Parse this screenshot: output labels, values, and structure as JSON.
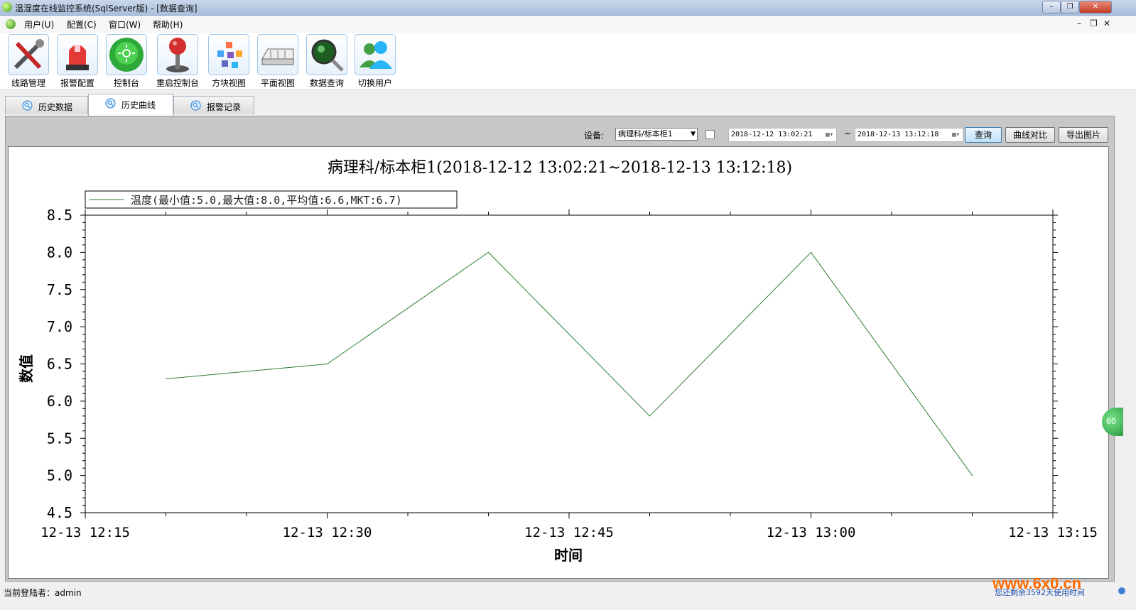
{
  "window": {
    "title": "温湿度在线监控系统(SqlServer版) - [数据查询]"
  },
  "menu": [
    "用户(U)",
    "配置(C)",
    "窗口(W)",
    "帮助(H)"
  ],
  "mdi_controls": {
    "minimize": "–",
    "restore": "❐",
    "close": "✕"
  },
  "toolbar": [
    {
      "label": "线路管理",
      "icon": "tools-icon"
    },
    {
      "label": "报警配置",
      "icon": "alarm-light-icon"
    },
    {
      "label": "控制台",
      "icon": "console-icon"
    },
    {
      "label": "重启控制台",
      "icon": "joystick-icon"
    },
    {
      "label": "方块视图",
      "icon": "block-view-icon"
    },
    {
      "label": "平面视图",
      "icon": "floor-plan-icon"
    },
    {
      "label": "数据查询",
      "icon": "magnifier-icon"
    },
    {
      "label": "切换用户",
      "icon": "switch-user-icon"
    }
  ],
  "tabs": [
    {
      "label": "历史数据",
      "active": false
    },
    {
      "label": "历史曲线",
      "active": true
    },
    {
      "label": "报警记录",
      "active": false
    }
  ],
  "filter": {
    "device_label": "设备:",
    "device_value": "病理科/标本柜1",
    "start": "2018-12-12 13:02:21",
    "tilde": "~",
    "end": "2018-12-13 13:12:18",
    "query_button": "查询",
    "compare_button": "曲线对比",
    "export_button": "导出图片"
  },
  "chart_data": {
    "type": "line",
    "title": "病理科/标本柜1(2018-12-12 13:02:21~2018-12-13 13:12:18)",
    "xlabel": "时间",
    "ylabel": "数值",
    "ylim": [
      4.5,
      8.5
    ],
    "yticks": [
      "4.5",
      "5.0",
      "5.5",
      "6.0",
      "6.5",
      "7.0",
      "7.5",
      "8.0",
      "8.5"
    ],
    "xticks": [
      "12-13 12:15",
      "12-13 12:30",
      "12-13 12:45",
      "12-13 13:00",
      "12-13 13:15"
    ],
    "x_range_minutes_labels": [
      "12-13 12:15",
      "12-13 13:15"
    ],
    "series": [
      {
        "name": "温度(最小值:5.0,最大值:8.0,平均值:6.6,MKT:6.7)",
        "color": "#2e7d32",
        "x": [
          "12-13 12:20",
          "12-13 12:30",
          "12-13 12:40",
          "12-13 12:50",
          "12-13 13:00",
          "12-13 13:10"
        ],
        "values": [
          6.3,
          6.5,
          8.0,
          5.8,
          8.0,
          5.0
        ]
      }
    ],
    "legend": "top-left",
    "grid": false
  },
  "statusbar": {
    "user": "当前登陆者：admin",
    "watermark": "www.6x0.cn",
    "remaining": "您还剩余3592天使用时间",
    "side_badge": "60"
  }
}
